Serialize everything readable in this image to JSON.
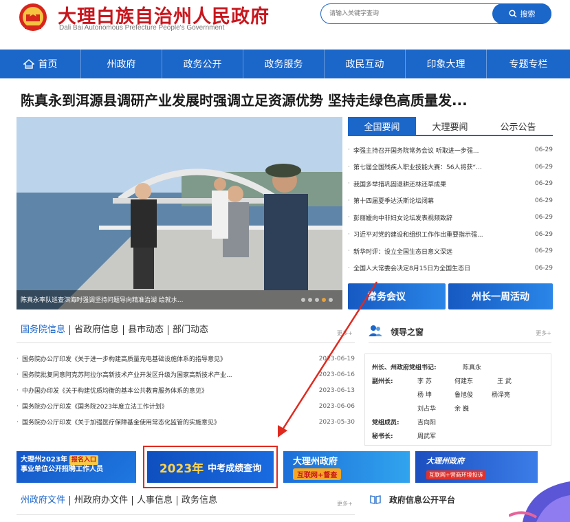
{
  "header": {
    "title": "大理白族自治州人民政府",
    "subtitle": "Dali Bai Autonomous Prefecture People's Government",
    "search_placeholder": "请输入关键字查询",
    "search_button": "搜索"
  },
  "nav": [
    {
      "label": "首页",
      "icon": "home-icon"
    },
    {
      "label": "州政府"
    },
    {
      "label": "政务公开"
    },
    {
      "label": "政务服务"
    },
    {
      "label": "政民互动"
    },
    {
      "label": "印象大理"
    },
    {
      "label": "专题专栏"
    }
  ],
  "headline": "陈真永到洱源县调研产业发展时强调立足资源优势 坚持走绿色高质量发...",
  "photo": {
    "caption": "陈真永率队巡查洱海时强调坚持问题导向精准治湖 绘就水..."
  },
  "news": {
    "tabs": [
      "全国要闻",
      "大理要闻",
      "公示公告"
    ],
    "items": [
      {
        "title": "李强主持召开国务院常务会议 听取进一步强...",
        "date": "06-29"
      },
      {
        "title": "第七届全国残疾人职业技能大赛：56人将获“...",
        "date": "06-29"
      },
      {
        "title": "我国多举措巩固退耕还林还草成果",
        "date": "06-29"
      },
      {
        "title": "第十四届夏季达沃斯论坛闭幕",
        "date": "06-29"
      },
      {
        "title": "彭丽媛向中非妇女论坛发表视频致辞",
        "date": "06-29"
      },
      {
        "title": "习近平对党的建设和组织工作作出重要指示强...",
        "date": "06-29"
      },
      {
        "title": "新华时评：设立全国生态日意义深远",
        "date": "06-29"
      },
      {
        "title": "全国人大常委会决定8月15日为全国生态日",
        "date": "06-29"
      }
    ],
    "banner_meeting": "常务会议",
    "banner_weekly": "州长一周活动"
  },
  "info": {
    "tabs": [
      "国务院信息",
      "省政府信息",
      "县市动态",
      "部门动态"
    ],
    "more": "更多+",
    "items": [
      {
        "title": "国务院办公厅印发《关于进一步构建高质量充电基础设施体系的指导意见》",
        "date": "2023-06-19"
      },
      {
        "title": "国务院批复同意阿克苏阿拉尔高新技术产业开发区升级为国家高新技术产业...",
        "date": "2023-06-16"
      },
      {
        "title": "中办国办印发《关于构建优质均衡的基本公共教育服务体系的意见》",
        "date": "2023-06-13"
      },
      {
        "title": "国务院办公厅印发《国务院2023年度立法工作计划》",
        "date": "2023-06-06"
      },
      {
        "title": "国务院办公厅印发《关于加强医疗保障基金使用常态化监管的实施意见》",
        "date": "2023-05-30"
      }
    ]
  },
  "leaders": {
    "title": "领导之窗",
    "more": "更多+",
    "secretary_role": "州长、州政府党组书记:",
    "secretary_name": "陈真永",
    "deputy_role": "副州长:",
    "deputies": [
      "李 苏",
      "何建东",
      "王 武",
      "杨 坤",
      "鲁旭俊",
      "杨泽亮",
      "刘占华",
      "余 巍"
    ],
    "member_role": "党组成员:",
    "member_name": "吉向阳",
    "clerk_role": "秘书长:",
    "clerk_name": "周武军"
  },
  "banners": {
    "recruit_line1": "大理州2023年",
    "recruit_tag": "报名入口",
    "recruit_line2": "事业单位公开招聘工作人员",
    "exam_year": "2023年",
    "exam_label": "中考成绩查询",
    "gov_line1": "大理州政府",
    "gov_line2": "互联网+督查",
    "govb_line1": "大理州政府",
    "govb_line2": "互联网+营商环境投诉"
  },
  "docs": {
    "tabs": [
      "州政府文件",
      "州政府办文件",
      "人事信息",
      "政务信息"
    ],
    "more": "更多+",
    "platform_title": "政府信息公开平台"
  },
  "colors": {
    "brand_blue": "#1b66c9",
    "title_red": "#c8161d",
    "annotation_red": "#e02a1f"
  }
}
